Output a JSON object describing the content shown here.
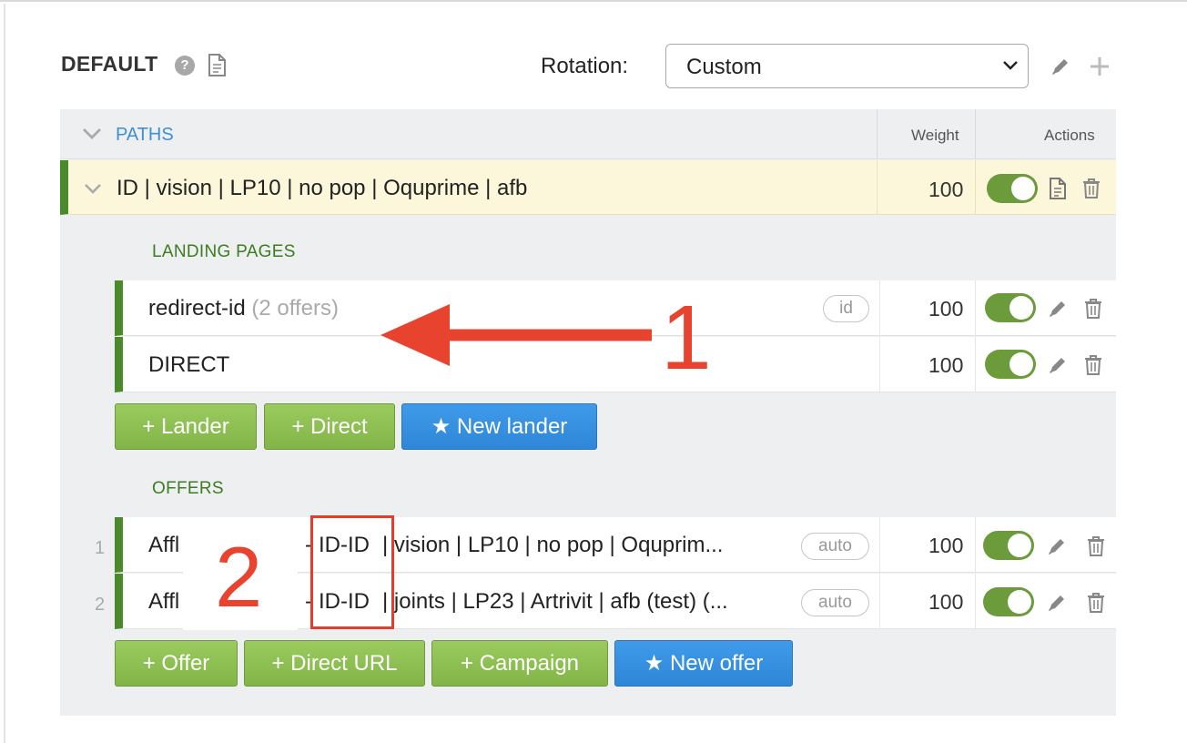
{
  "header": {
    "title": "DEFAULT",
    "help_icon": "?",
    "rotation_label": "Rotation:",
    "rotation_value": "Custom"
  },
  "table": {
    "paths_label": "PATHS",
    "weight_header": "Weight",
    "actions_header": "Actions"
  },
  "path": {
    "name": "ID | vision | LP10 | no pop | Oquprime | afb",
    "weight": "100",
    "enabled": true
  },
  "landing_pages": {
    "label": "LANDING PAGES",
    "rows": [
      {
        "name": "redirect-id",
        "extra": "(2 offers)",
        "tag": "id",
        "weight": "100",
        "enabled": true
      },
      {
        "name": "DIRECT",
        "extra": "",
        "tag": "",
        "weight": "100",
        "enabled": true
      }
    ],
    "buttons": {
      "lander": "+ Lander",
      "direct": "+ Direct",
      "new_lander": "New lander"
    }
  },
  "offers": {
    "label": "OFFERS",
    "rows": [
      {
        "num": "1",
        "name_start": "Affl",
        "name_dash": "-",
        "name_highlight": "ID-ID",
        "name_rest": "| vision | LP10 | no pop | Oquprim...",
        "tag": "auto",
        "weight": "100",
        "enabled": true
      },
      {
        "num": "2",
        "name_start": "Affl",
        "name_dash": "-",
        "name_highlight": "ID-ID",
        "name_rest": "| joints | LP23 | Artrivit | afb (test) (...",
        "tag": "auto",
        "weight": "100",
        "enabled": true
      }
    ],
    "buttons": {
      "offer": "+ Offer",
      "direct_url": "+ Direct URL",
      "campaign": "+ Campaign",
      "new_offer": "New offer"
    }
  },
  "annotations": {
    "label_1": "1",
    "label_2": "2",
    "color": "#e8432f"
  },
  "colors": {
    "path_accent": "#4b8a2a",
    "link_blue": "#3f8fd2",
    "button_green": "#8cbf51",
    "button_blue": "#3a92e2",
    "toggle_on": "#6b9b3a"
  }
}
